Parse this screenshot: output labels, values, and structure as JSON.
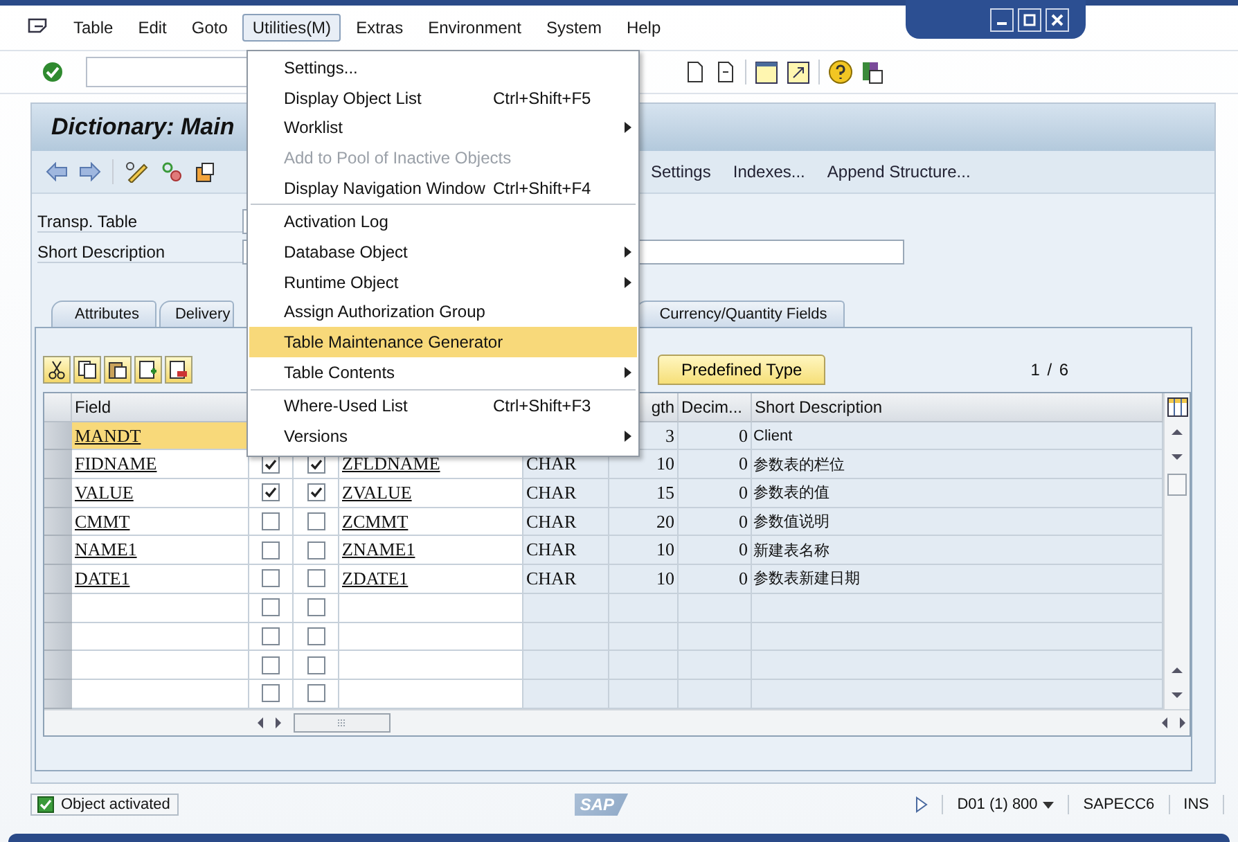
{
  "menubar": {
    "items": [
      {
        "label": "Table",
        "selected": false
      },
      {
        "label": "Edit",
        "selected": false
      },
      {
        "label": "Goto",
        "selected": false
      },
      {
        "label": "Utilities(M)",
        "selected": true
      },
      {
        "label": "Extras",
        "selected": false
      },
      {
        "label": "Environment",
        "selected": false
      },
      {
        "label": "System",
        "selected": false
      },
      {
        "label": "Help",
        "selected": false
      }
    ]
  },
  "title": "Dictionary: Main",
  "app_toolbar": {
    "buttons": [
      "Settings",
      "Indexes...",
      "Append Structure..."
    ]
  },
  "fields": [
    {
      "label": "Transp. Table"
    },
    {
      "label": "Short Description"
    }
  ],
  "tabs": [
    {
      "label": "Attributes",
      "selected": false
    },
    {
      "label": "Delivery",
      "selected": false
    },
    {
      "label": "Currency/Quantity Fields",
      "selected": false
    }
  ],
  "table_toolbar": {
    "button": "Predefined Type",
    "page": "1 / 6"
  },
  "table": {
    "columns": [
      "Field",
      "gth",
      "Decim...",
      "Short Description"
    ],
    "rows": [
      {
        "field": "MANDT",
        "length": "3",
        "decimals": "0",
        "description": "Client",
        "selected": true
      },
      {
        "field": "FIDNAME",
        "key": true,
        "initial": true,
        "data_element": "ZFLDNAME",
        "type": "CHAR",
        "length": "10",
        "decimals": "0",
        "description": "参数表的栏位",
        "selected": false
      },
      {
        "field": "VALUE",
        "key": true,
        "initial": true,
        "data_element": "ZVALUE",
        "type": "CHAR",
        "length": "15",
        "decimals": "0",
        "description": "参数表的值",
        "selected": false
      },
      {
        "field": "CMMT",
        "key": false,
        "initial": false,
        "data_element": "ZCMMT",
        "type": "CHAR",
        "length": "20",
        "decimals": "0",
        "description": "参数值说明",
        "selected": false
      },
      {
        "field": "NAME1",
        "key": false,
        "initial": false,
        "data_element": "ZNAME1",
        "type": "CHAR",
        "length": "10",
        "decimals": "0",
        "description": "新建表名称",
        "selected": false
      },
      {
        "field": "DATE1",
        "key": false,
        "initial": false,
        "data_element": "ZDATE1",
        "type": "CHAR",
        "length": "10",
        "decimals": "0",
        "description": "参数表新建日期",
        "selected": false
      },
      {
        "key": false,
        "initial": false,
        "selected": false
      },
      {
        "key": false,
        "initial": false,
        "selected": false
      },
      {
        "key": false,
        "initial": false,
        "selected": false
      },
      {
        "key": false,
        "initial": false,
        "selected": false
      }
    ]
  },
  "menu": {
    "groups": [
      [
        {
          "label": "Settings...",
          "selected": false,
          "disabled": false,
          "submenu": false
        },
        {
          "label": "Display Object List",
          "shortcut": "Ctrl+Shift+F5",
          "selected": false,
          "disabled": false,
          "submenu": false
        },
        {
          "label": "Worklist",
          "selected": false,
          "disabled": false,
          "submenu": true
        },
        {
          "label": "Add to Pool of Inactive Objects",
          "selected": false,
          "disabled": true,
          "submenu": false
        },
        {
          "label": "Display Navigation Window",
          "shortcut": "Ctrl+Shift+F4",
          "selected": false,
          "disabled": false,
          "submenu": false
        }
      ],
      [
        {
          "label": "Activation Log",
          "selected": false,
          "disabled": false,
          "submenu": false
        },
        {
          "label": "Database Object",
          "selected": false,
          "disabled": false,
          "submenu": true
        },
        {
          "label": "Runtime Object",
          "selected": false,
          "disabled": false,
          "submenu": true
        },
        {
          "label": "Assign Authorization Group",
          "selected": false,
          "disabled": false,
          "submenu": false
        },
        {
          "label": "Table Maintenance Generator",
          "selected": true,
          "disabled": false,
          "submenu": false
        },
        {
          "label": "Table Contents",
          "selected": false,
          "disabled": false,
          "submenu": true
        }
      ],
      [
        {
          "label": "Where-Used List",
          "shortcut": "Ctrl+Shift+F3",
          "selected": false,
          "disabled": false,
          "submenu": false
        },
        {
          "label": "Versions",
          "selected": false,
          "disabled": false,
          "submenu": true
        }
      ]
    ]
  },
  "status_bar": {
    "message": "Object activated",
    "logo": "SAP",
    "system": "D01 (1) 800",
    "server": "SAPECC6",
    "mode": "INS"
  }
}
